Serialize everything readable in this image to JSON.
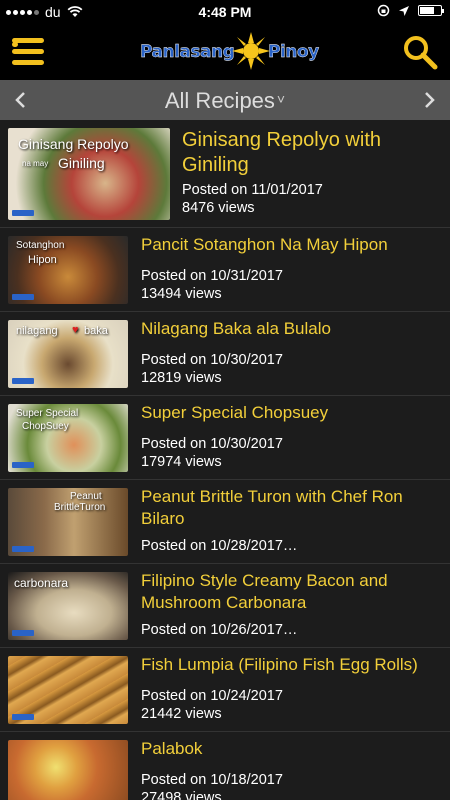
{
  "status_bar": {
    "carrier": "du",
    "time": "4:48 PM",
    "battery_level": 0.7
  },
  "header": {
    "logo_left": "Panlasang",
    "logo_right": "Pinoy"
  },
  "nav": {
    "title": "All Recipes",
    "chevron": "˅"
  },
  "recipes": [
    {
      "title": "Ginisang Repolyo with Giniling",
      "posted": "Posted on 11/01/2017",
      "views": "8476 views",
      "thumb_label_1": "Ginisang Repolyo",
      "thumb_label_2": "Giniling",
      "thumb_small": "na may"
    },
    {
      "title": "Pancit Sotanghon Na May Hipon",
      "posted": "Posted on 10/31/2017",
      "views": "13494 views",
      "thumb_label_1": "Sotanghon",
      "thumb_label_2": "Hipon"
    },
    {
      "title": "Nilagang Baka ala Bulalo",
      "posted": "Posted on 10/30/2017",
      "views": "12819 views",
      "thumb_label_1": "nilagang",
      "thumb_label_2": "baka"
    },
    {
      "title": "Super Special Chopsuey",
      "posted": "Posted on 10/30/2017",
      "views": "17974 views",
      "thumb_label_1": "Super Special",
      "thumb_label_2": "ChopSuey"
    },
    {
      "title": "Peanut Brittle Turon with Chef Ron Bilaro",
      "posted": "Posted on 10/28/2017…",
      "thumb_label_1": "Peanut",
      "thumb_label_2": "BrittleTuron"
    },
    {
      "title": "Filipino Style Creamy Bacon and Mushroom Carbonara",
      "posted": "Posted on 10/26/2017…",
      "thumb_label_1": "carbonara"
    },
    {
      "title": "Fish Lumpia (Filipino Fish Egg Rolls)",
      "posted": "Posted on 10/24/2017",
      "views": "21442 views"
    },
    {
      "title": "Palabok",
      "posted": "Posted on 10/18/2017",
      "views": "27498 views"
    }
  ]
}
